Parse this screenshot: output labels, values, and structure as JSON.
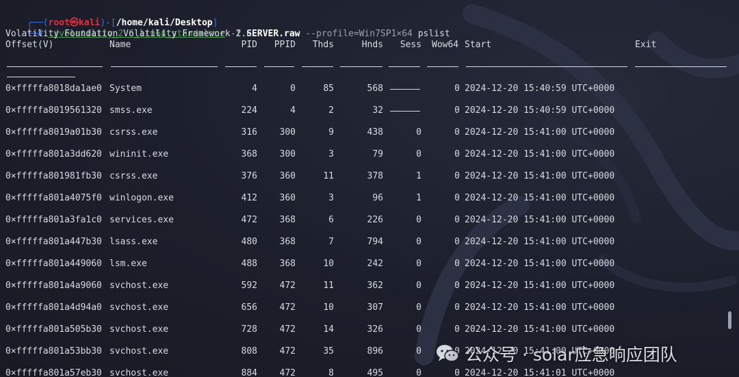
{
  "prompt": {
    "open": "┌──(",
    "user": "root㉿kali",
    "sep": ")-[",
    "path": "/home/kali/Desktop",
    "close": "]",
    "second": "└─",
    "hash": "# "
  },
  "command": {
    "program": "./volatility_2.6_lin64_standalone",
    "flag_f": " -f ",
    "file": "SERVER.raw",
    "profile": " --profile=Win7SP1×64",
    "plugin": " pslist"
  },
  "banner": "Volatility Foundation Volatility Framework 2.6",
  "table": {
    "headers": {
      "offset": "Offset(V)",
      "name": "Name",
      "pid": "PID",
      "ppid": "PPID",
      "thds": "Thds",
      "hnds": "Hnds",
      "sess": "Sess",
      "wow64": "Wow64",
      "start": "Start",
      "exit": "Exit"
    },
    "rows": [
      {
        "offset": "0×fffffa8018da1ae0",
        "name": "System",
        "pid": "4",
        "ppid": "0",
        "thds": "85",
        "hnds": "568",
        "sess": "",
        "sess_dash": true,
        "wow64": "0",
        "start": "2024-12-20 15:40:59 UTC+0000"
      },
      {
        "offset": "0×fffffa8019561320",
        "name": "smss.exe",
        "pid": "224",
        "ppid": "4",
        "thds": "2",
        "hnds": "32",
        "sess": "",
        "sess_dash": true,
        "wow64": "0",
        "start": "2024-12-20 15:40:59 UTC+0000"
      },
      {
        "offset": "0×fffffa8019a01b30",
        "name": "csrss.exe",
        "pid": "316",
        "ppid": "300",
        "thds": "9",
        "hnds": "438",
        "sess": "0",
        "sess_dash": false,
        "wow64": "0",
        "start": "2024-12-20 15:41:00 UTC+0000"
      },
      {
        "offset": "0×fffffa801a3dd620",
        "name": "wininit.exe",
        "pid": "368",
        "ppid": "300",
        "thds": "3",
        "hnds": "79",
        "sess": "0",
        "sess_dash": false,
        "wow64": "0",
        "start": "2024-12-20 15:41:00 UTC+0000"
      },
      {
        "offset": "0×fffffa801981fb30",
        "name": "csrss.exe",
        "pid": "376",
        "ppid": "360",
        "thds": "11",
        "hnds": "378",
        "sess": "1",
        "sess_dash": false,
        "wow64": "0",
        "start": "2024-12-20 15:41:00 UTC+0000"
      },
      {
        "offset": "0×fffffa801a4075f0",
        "name": "winlogon.exe",
        "pid": "412",
        "ppid": "360",
        "thds": "3",
        "hnds": "96",
        "sess": "1",
        "sess_dash": false,
        "wow64": "0",
        "start": "2024-12-20 15:41:00 UTC+0000"
      },
      {
        "offset": "0×fffffa801a3fa1c0",
        "name": "services.exe",
        "pid": "472",
        "ppid": "368",
        "thds": "6",
        "hnds": "226",
        "sess": "0",
        "sess_dash": false,
        "wow64": "0",
        "start": "2024-12-20 15:41:00 UTC+0000"
      },
      {
        "offset": "0×fffffa801a447b30",
        "name": "lsass.exe",
        "pid": "480",
        "ppid": "368",
        "thds": "7",
        "hnds": "794",
        "sess": "0",
        "sess_dash": false,
        "wow64": "0",
        "start": "2024-12-20 15:41:00 UTC+0000"
      },
      {
        "offset": "0×fffffa801a449060",
        "name": "lsm.exe",
        "pid": "488",
        "ppid": "368",
        "thds": "10",
        "hnds": "242",
        "sess": "0",
        "sess_dash": false,
        "wow64": "0",
        "start": "2024-12-20 15:41:00 UTC+0000"
      },
      {
        "offset": "0×fffffa801a4a9060",
        "name": "svchost.exe",
        "pid": "592",
        "ppid": "472",
        "thds": "11",
        "hnds": "362",
        "sess": "0",
        "sess_dash": false,
        "wow64": "0",
        "start": "2024-12-20 15:41:00 UTC+0000"
      },
      {
        "offset": "0×fffffa801a4d94a0",
        "name": "svchost.exe",
        "pid": "656",
        "ppid": "472",
        "thds": "10",
        "hnds": "307",
        "sess": "0",
        "sess_dash": false,
        "wow64": "0",
        "start": "2024-12-20 15:41:00 UTC+0000"
      },
      {
        "offset": "0×fffffa801a505b30",
        "name": "svchost.exe",
        "pid": "728",
        "ppid": "472",
        "thds": "14",
        "hnds": "326",
        "sess": "0",
        "sess_dash": false,
        "wow64": "0",
        "start": "2024-12-20 15:41:00 UTC+0000"
      },
      {
        "offset": "0×fffffa801a53bb30",
        "name": "svchost.exe",
        "pid": "808",
        "ppid": "472",
        "thds": "35",
        "hnds": "896",
        "sess": "0",
        "sess_dash": false,
        "wow64": "0",
        "start": "2024-12-20 15:41:00 UTC+0000"
      },
      {
        "offset": "0×fffffa801a57eb30",
        "name": "svchost.exe",
        "pid": "884",
        "ppid": "472",
        "thds": "8",
        "hnds": "495",
        "sess": "0",
        "sess_dash": false,
        "wow64": "0",
        "start": "2024-12-20 15:41:01 UTC+0000"
      }
    ]
  },
  "watermark": {
    "icon": "wechat-icon",
    "text": "公众号 · solar应急响应团队"
  },
  "colors": {
    "background": "#1c1f2b",
    "prompt_blue": "#3d6fe0",
    "prompt_red": "#e02f44",
    "command_green": "#4f9e5a",
    "text": "#d8dbe2",
    "muted": "#9aa0ad"
  }
}
